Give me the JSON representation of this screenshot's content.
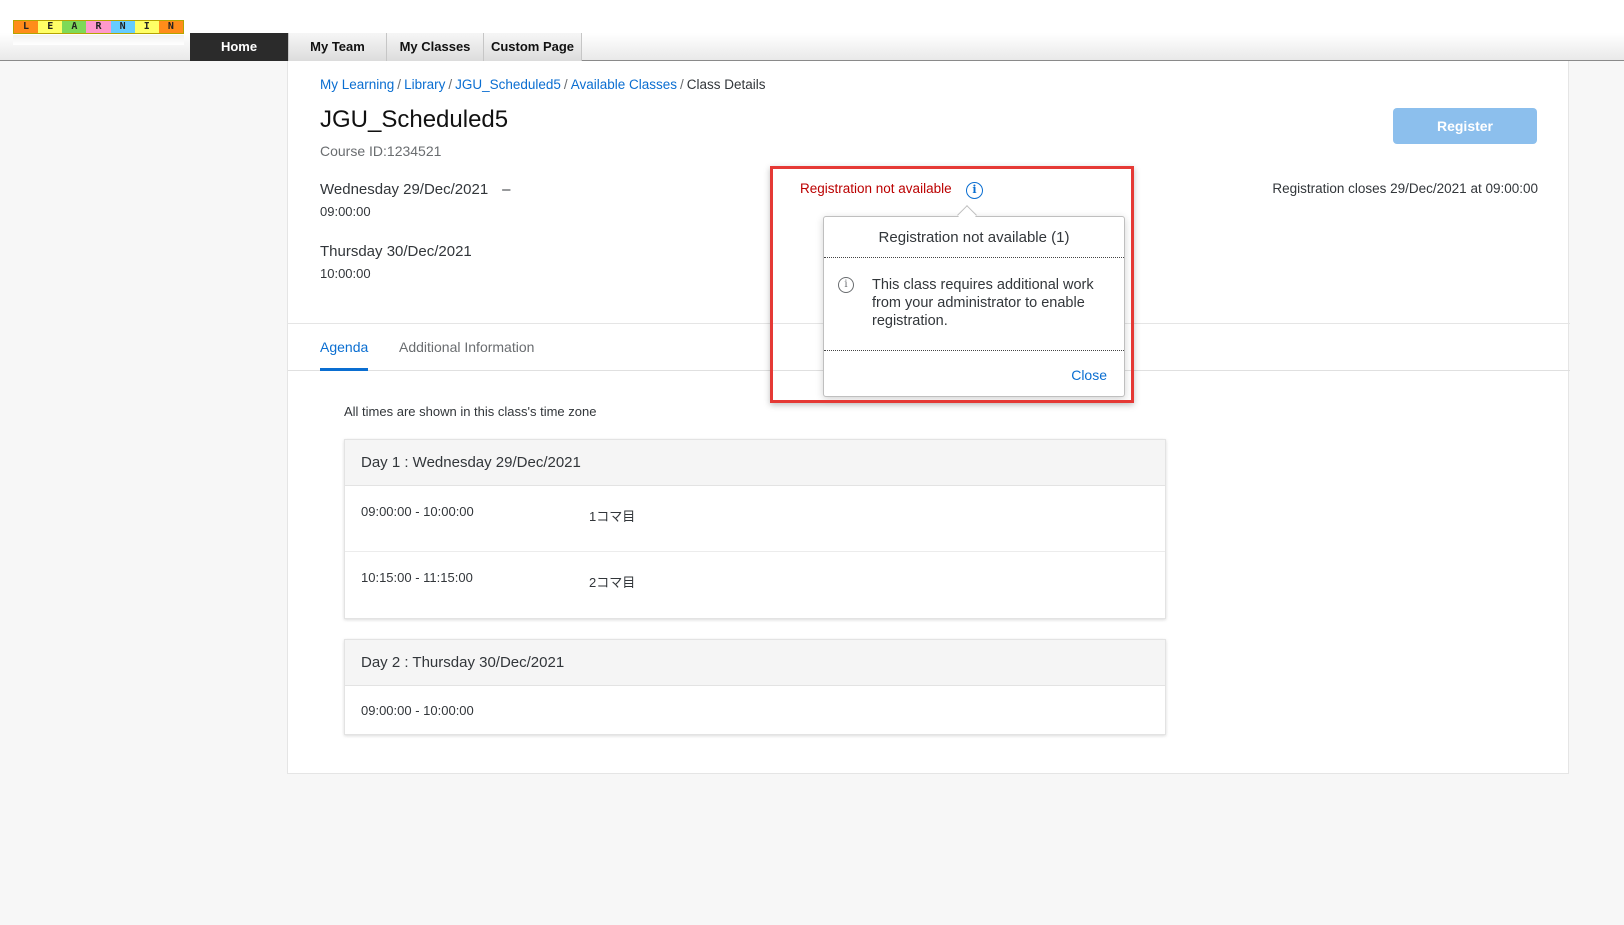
{
  "logo": {
    "letters": [
      "L",
      "E",
      "A",
      "R",
      "N",
      "I",
      "N"
    ]
  },
  "nav": {
    "tabs": [
      {
        "label": "Home",
        "active": true
      },
      {
        "label": "My Team",
        "active": false
      },
      {
        "label": "My Classes",
        "active": false
      },
      {
        "label": "Custom Page",
        "active": false
      }
    ]
  },
  "breadcrumb": {
    "items": [
      "My Learning",
      "Library",
      "JGU_Scheduled5",
      "Available Classes"
    ],
    "current": "Class Details",
    "separator": "/"
  },
  "class": {
    "title": "JGU_Scheduled5",
    "course_id": "Course ID:1234521",
    "start_date": "Wednesday 29/Dec/2021",
    "start_time": "09:00:00",
    "dash": "–",
    "end_date": "Thursday 30/Dec/2021",
    "end_time": "10:00:00"
  },
  "register": {
    "button_label": "Register",
    "closes_text": "Registration closes 29/Dec/2021 at 09:00:00",
    "status_text": "Registration not available"
  },
  "popover": {
    "title": "Registration not available (1)",
    "message": "This class requires additional work from your administrator to enable registration.",
    "close_label": "Close"
  },
  "tabs": [
    {
      "label": "Agenda",
      "active": true
    },
    {
      "label": "Additional Information",
      "active": false
    }
  ],
  "agenda": {
    "timezone_note": "All times are shown in this class's time zone",
    "days": [
      {
        "label": "Day 1 : Wednesday 29/Dec/2021",
        "sessions": [
          {
            "time": "09:00:00 - 10:00:00",
            "name": "1コマ目"
          },
          {
            "time": "10:15:00 - 11:15:00",
            "name": "2コマ目"
          }
        ]
      },
      {
        "label": "Day 2 : Thursday 30/Dec/2021",
        "sessions": [
          {
            "time": "09:00:00 - 10:00:00",
            "name": ""
          }
        ]
      }
    ]
  },
  "colors": {
    "link_blue": "#0a6ed1",
    "error_red": "#bb0000",
    "highlight_red": "#e53935",
    "register_disabled": "#8cbfed"
  },
  "icons": {
    "status_info": "info-icon",
    "popover_info": "info-icon"
  }
}
